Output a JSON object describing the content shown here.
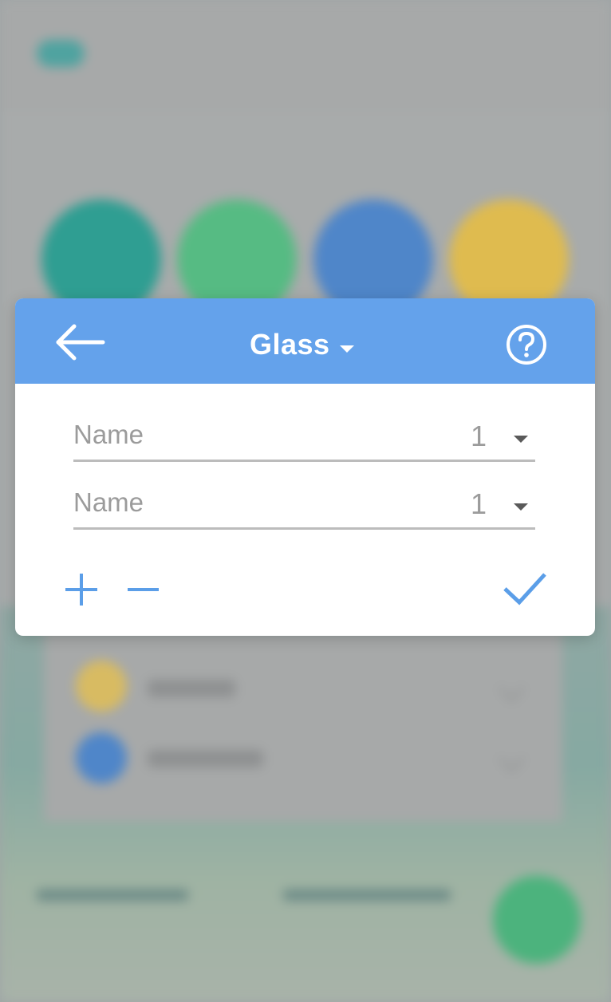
{
  "dialog": {
    "title": "Glass",
    "rows": [
      {
        "placeholder": "Name",
        "quantity": "1"
      },
      {
        "placeholder": "Name",
        "quantity": "1"
      }
    ]
  },
  "colors": {
    "header": "#64a2eb",
    "accent": "#5b9ee8",
    "input_text": "#9b9b9b",
    "underline": "#bcbcbc"
  },
  "icons": {
    "back": "arrow-left-icon",
    "help": "question-circle-icon",
    "add": "plus-icon",
    "remove": "minus-icon",
    "confirm": "check-icon"
  }
}
